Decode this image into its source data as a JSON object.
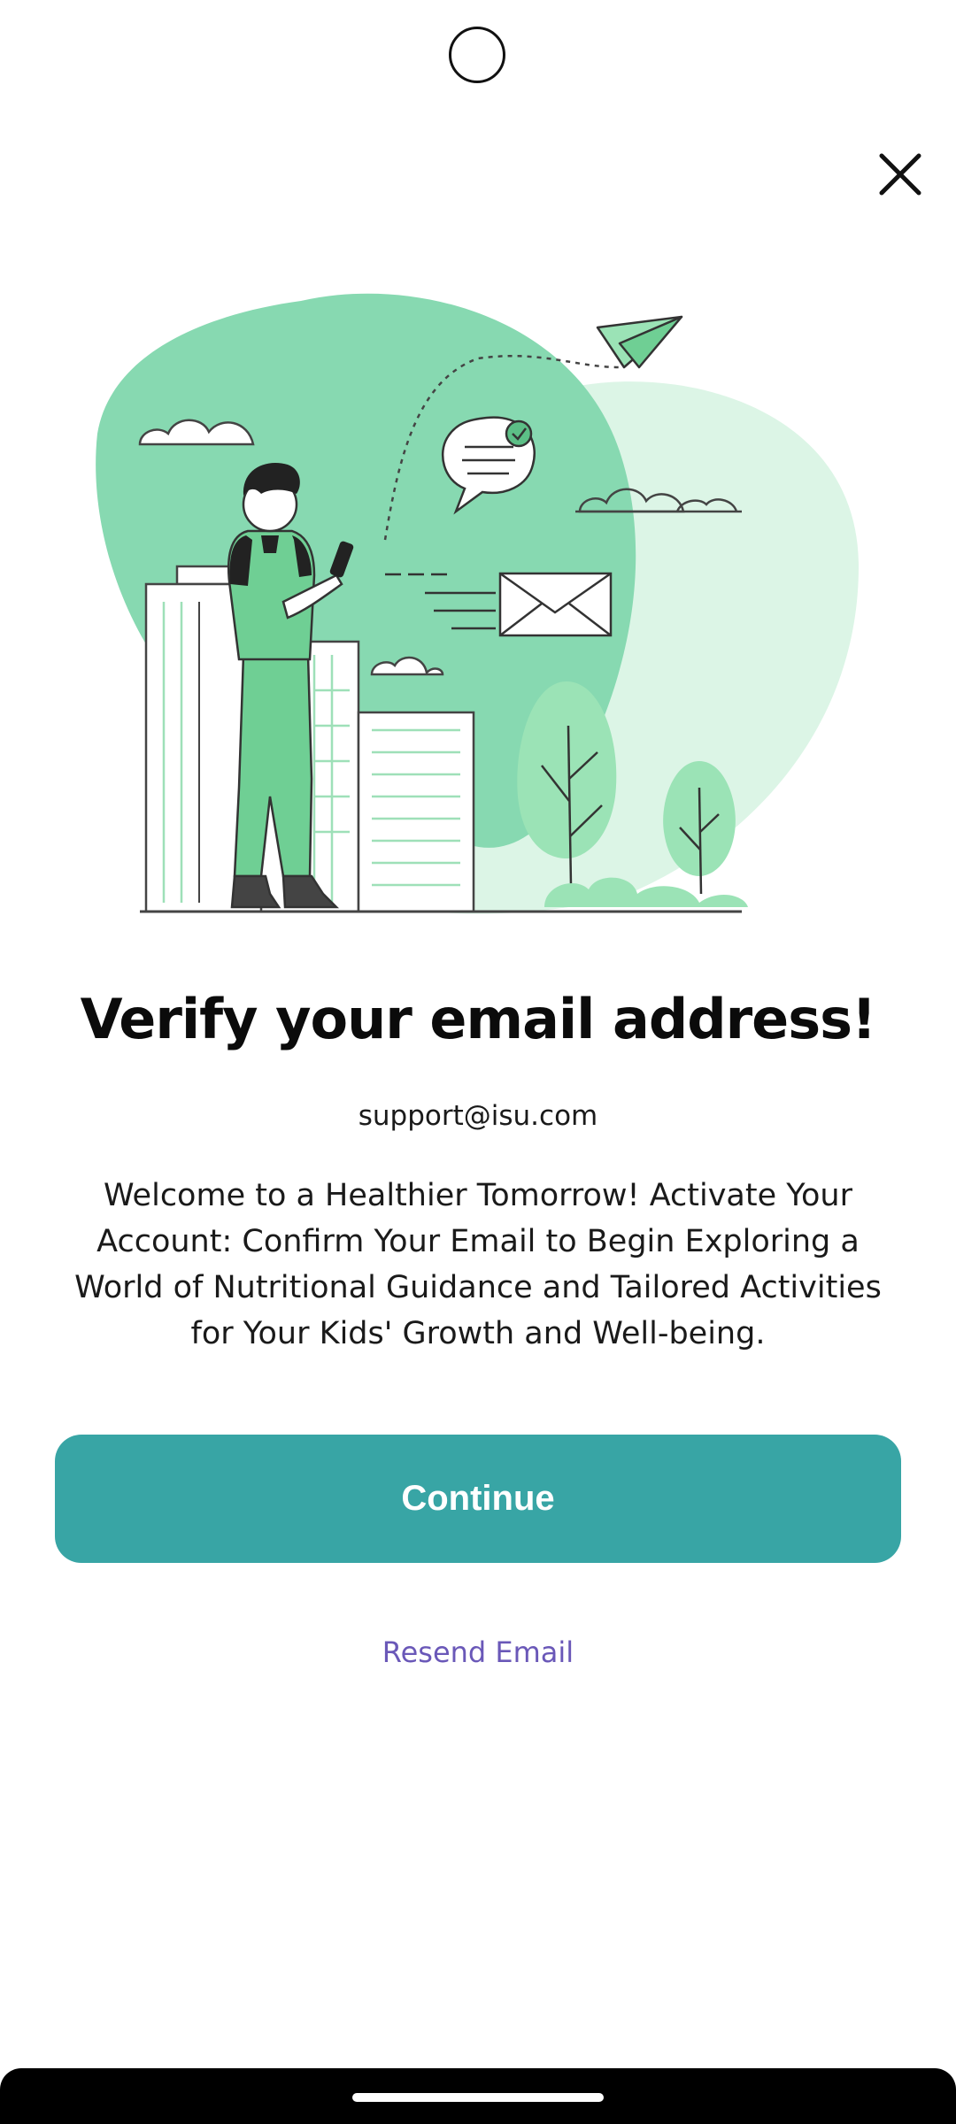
{
  "screen": {
    "title": "Verify your email address!",
    "email": "support@isu.com",
    "message": "Welcome to a Healthier Tomorrow! Activate Your Account: Confirm Your Email to Begin Exploring a World of Nutritional Guidance and Tailored Activities for Your Kids' Growth and Well-being.",
    "continue_label": "Continue",
    "resend_label": "Resend Email"
  },
  "icons": {
    "close": "close-icon",
    "illustration": "email-verification-illustration"
  },
  "colors": {
    "primary_button": "#38a5a5",
    "link": "#6a58b8",
    "illustration_green_dark": "#87d9b1",
    "illustration_green_light": "#dcf5e6"
  }
}
